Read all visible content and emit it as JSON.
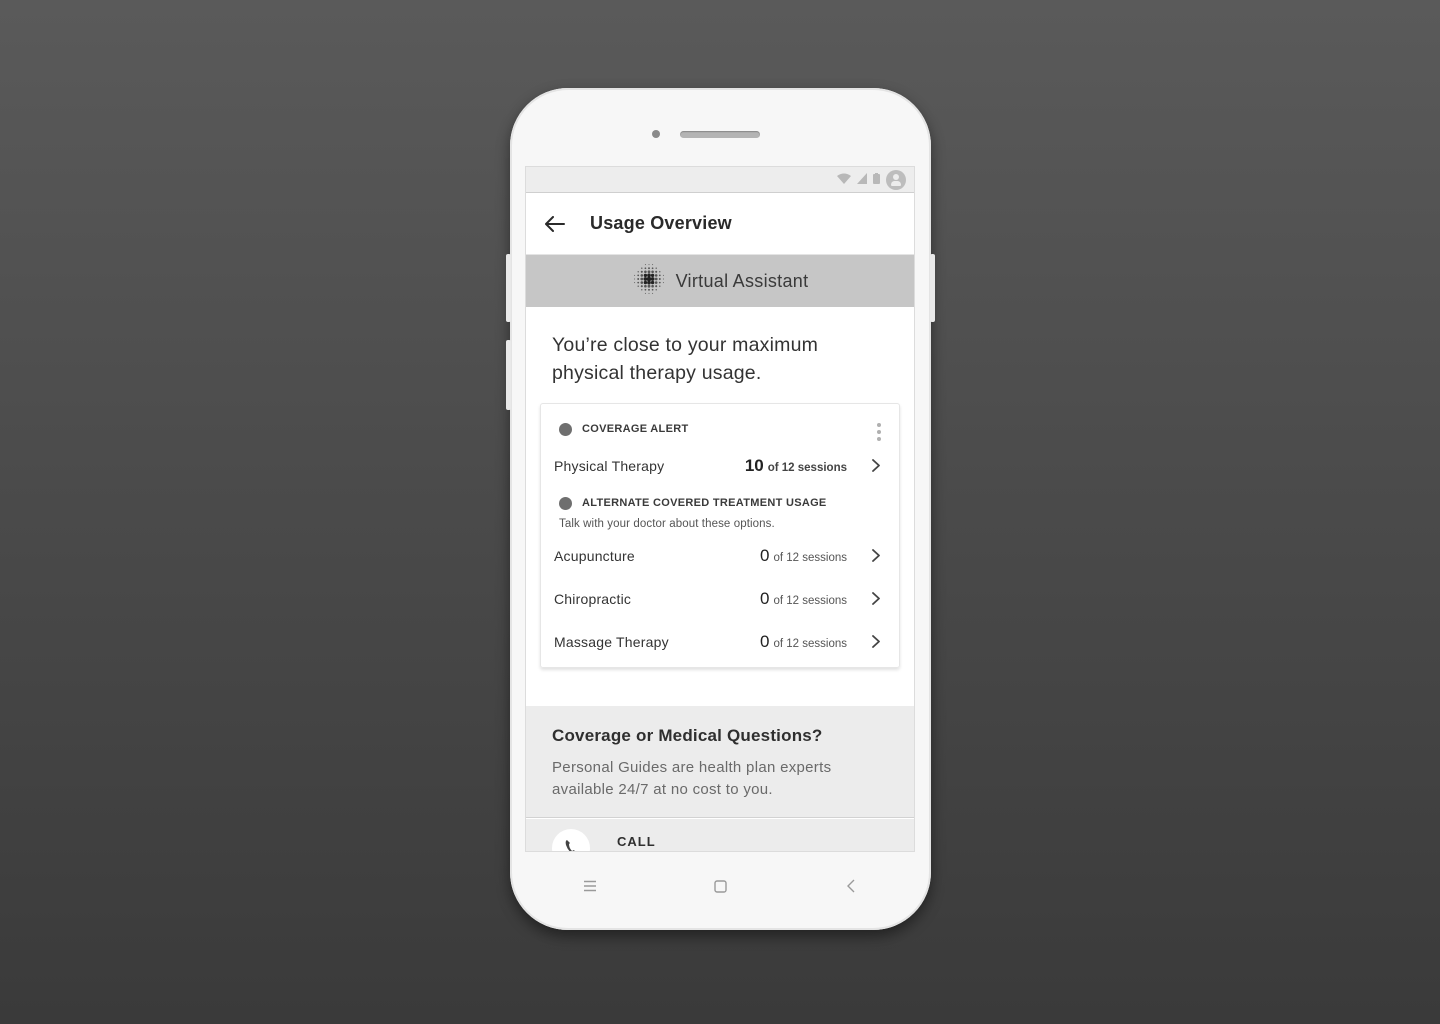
{
  "app": {
    "title": "Usage Overview",
    "assistant_label": "Virtual Assistant"
  },
  "headline": "You’re close to your maximum physical therapy usage.",
  "card": {
    "alert_title": "COVERAGE ALERT",
    "primary": {
      "label": "Physical Therapy",
      "count": "10",
      "suffix": "of 12 sessions"
    },
    "alternate_title": "ALTERNATE COVERED TREATMENT USAGE",
    "alternate_note": "Talk with your doctor about these options.",
    "alternates": [
      {
        "label": "Acupuncture",
        "count": "0",
        "suffix": "of 12 sessions"
      },
      {
        "label": "Chiropractic",
        "count": "0",
        "suffix": "of 12 sessions"
      },
      {
        "label": "Massage Therapy",
        "count": "0",
        "suffix": "of 12 sessions"
      }
    ]
  },
  "help": {
    "title": "Coverage or Medical Questions?",
    "subtitle": "Personal Guides are health plan experts available 24/7 at no cost to you.",
    "call_label": "CALL"
  },
  "icons": {
    "back": "arrow-left-icon",
    "assistant": "dotted-orb-icon",
    "chevron": "chevron-right-icon",
    "more": "kebab-menu-icon",
    "phone": "phone-icon"
  },
  "colors": {
    "assistant_bar": "#c6c6c6",
    "help_bg": "#ececec",
    "dot": "#6f6f6f"
  }
}
